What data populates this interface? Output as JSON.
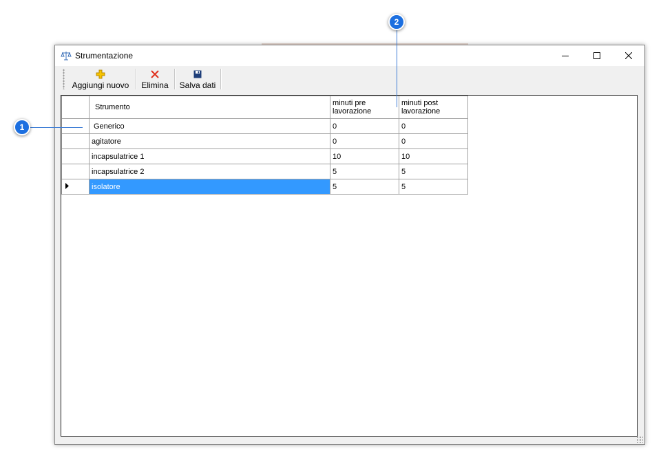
{
  "window": {
    "title": "Strumentazione",
    "icon": "balance-scale-icon",
    "controls": {
      "minimize": "minimize-icon",
      "maximize": "maximize-icon",
      "close": "close-icon"
    }
  },
  "toolbar": {
    "add_label": "Aggiungi nuovo",
    "delete_label": "Elimina",
    "save_label": "Salva dati",
    "add_icon": "plus-icon",
    "delete_icon": "x-icon",
    "save_icon": "floppy-disk-icon"
  },
  "grid": {
    "columns": [
      "Strumento",
      "minuti pre lavorazione",
      "minuti post lavorazione"
    ],
    "rows": [
      {
        "strumento": "Generico",
        "pre": "0",
        "post": "0"
      },
      {
        "strumento": "agitatore",
        "pre": "0",
        "post": "0"
      },
      {
        "strumento": "incapsulatrice 1",
        "pre": "10",
        "post": "10"
      },
      {
        "strumento": "incapsulatrice 2",
        "pre": "5",
        "post": "5"
      },
      {
        "strumento": "isolatore",
        "pre": "5",
        "post": "5"
      }
    ],
    "current_row_index": 4
  },
  "callouts": [
    "1",
    "2"
  ],
  "colors": {
    "selection": "#3399ff",
    "callout": "#1c6fe0",
    "delete_icon": "#e0301e",
    "add_icon": "#f2b600",
    "save_icon": "#1f3f7a"
  }
}
